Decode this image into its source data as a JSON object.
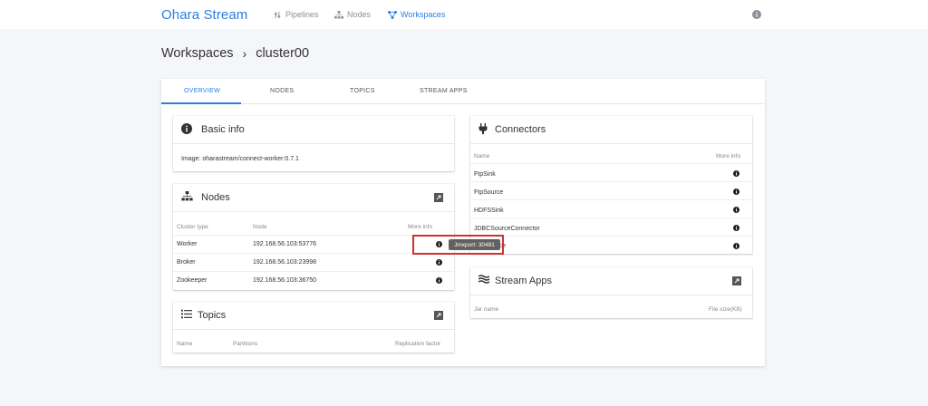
{
  "brand": "Ohara Stream",
  "nav": {
    "pipelines": "Pipelines",
    "nodes": "Nodes",
    "workspaces": "Workspaces"
  },
  "breadcrumb": {
    "root": "Workspaces",
    "separator": "›",
    "current": "cluster00"
  },
  "tabs": [
    "OVERVIEW",
    "NODES",
    "TOPICS",
    "STREAM APPS"
  ],
  "basic_info": {
    "title": "Basic info",
    "image_label": "Image: oharastream/connect-worker:0.7.1"
  },
  "nodes_card": {
    "title": "Nodes",
    "headers": {
      "type": "Cluster type",
      "node": "Node",
      "more": "More info"
    },
    "rows": [
      {
        "type": "Worker",
        "node": "192.168.56.103:53776"
      },
      {
        "type": "Broker",
        "node": "192.168.56.103:23998"
      },
      {
        "type": "Zookeeper",
        "node": "192.168.56.103:36750"
      }
    ]
  },
  "topics_card": {
    "title": "Topics",
    "headers": {
      "name": "Name",
      "partitions": "Partitions",
      "replication": "Replication factor"
    }
  },
  "connectors_card": {
    "title": "Connectors",
    "headers": {
      "name": "Name",
      "more": "More info"
    },
    "rows": [
      "FtpSink",
      "FtpSource",
      "HDFSSink",
      "JDBCSourceConnector",
      "PerfSource"
    ]
  },
  "stream_apps_card": {
    "title": "Stream Apps",
    "headers": {
      "jar": "Jar name",
      "size": "File size(KB)"
    }
  },
  "tooltip": "Jmxport: 30481",
  "colors": {
    "accent": "#2a7de1",
    "highlight": "#d32f2f",
    "tooltip_bg": "#616161"
  },
  "icons": {
    "pipelines": "sliders-icon",
    "nodes": "sitemap-icon",
    "workspaces": "share-nodes-icon",
    "help": "info-circle-icon",
    "basic_info": "info-circle-icon",
    "connectors": "plug-icon",
    "stream_apps": "stream-icon",
    "expand": "external-link-icon",
    "topics": "list-icon"
  }
}
